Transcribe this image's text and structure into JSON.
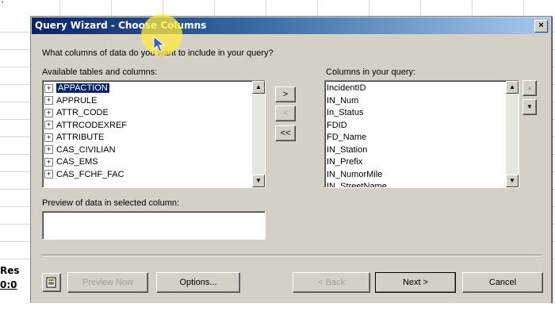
{
  "dialog": {
    "title": "Query Wizard - Choose Columns",
    "close_label": "×",
    "prompt": "What columns of data do you want to include in your query?"
  },
  "available": {
    "label": "Available tables and columns:",
    "items": [
      {
        "label": "APPACTION",
        "selected": true
      },
      {
        "label": "APPRULE"
      },
      {
        "label": "ATTR_CODE"
      },
      {
        "label": "ATTRCODEXREF"
      },
      {
        "label": "ATTRIBUTE"
      },
      {
        "label": "CAS_CIVILIAN"
      },
      {
        "label": "CAS_EMS"
      },
      {
        "label": "CAS_FCHF_FAC"
      }
    ],
    "expander_glyph": "+"
  },
  "move_buttons": {
    "add": ">",
    "remove": "<",
    "remove_all": "<<"
  },
  "query_columns": {
    "label": "Columns in your query:",
    "items": [
      "IncidentID",
      "IN_Num",
      "In_Status",
      "FDID",
      "FD_Name",
      "IN_Station",
      "IN_Prefix",
      "IN_NumorMile",
      "IN_StreetName"
    ]
  },
  "order_buttons": {
    "up": "▲",
    "down": "▼"
  },
  "preview": {
    "label": "Preview of data in selected column:",
    "value": ""
  },
  "footer": {
    "preview_now": "Preview Now",
    "options": "Options...",
    "back": "< Back",
    "next": "Next >",
    "cancel": "Cancel"
  },
  "sheet": {
    "row_label_1": "Res",
    "row_label_2": "0:0",
    "top_fragment": "'"
  }
}
